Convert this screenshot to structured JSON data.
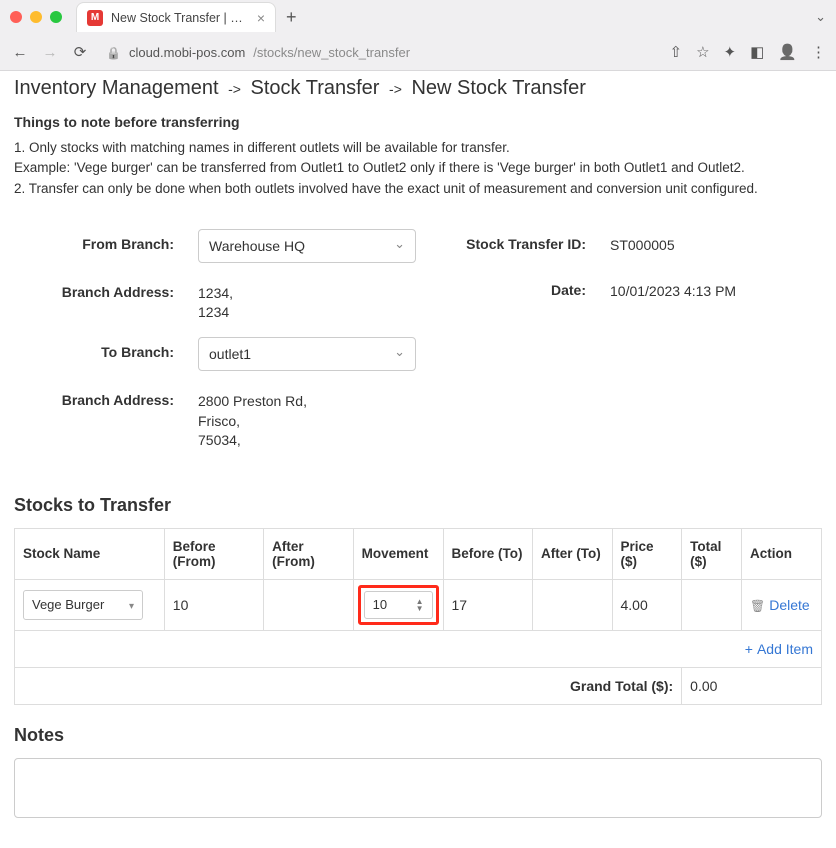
{
  "browser": {
    "tab_title": "New Stock Transfer | MobiPOS",
    "favicon_letter": "M",
    "url_host": "cloud.mobi-pos.com",
    "url_path": "/stocks/new_stock_transfer"
  },
  "breadcrumbs": {
    "a": "Inventory Management",
    "b": "Stock Transfer",
    "c": "New Stock Transfer"
  },
  "instructions": {
    "heading": "Things to note before transferring",
    "line1": "1. Only stocks with matching names in different outlets will be available for transfer.",
    "line1b": "Example: 'Vege burger' can be transferred from Outlet1 to Outlet2 only if there is 'Vege burger' in both Outlet1 and Outlet2.",
    "line2": "2. Transfer can only be done when both outlets involved have the exact unit of measurement and conversion unit configured."
  },
  "form": {
    "from_branch_label": "From Branch:",
    "from_branch_value": "Warehouse HQ",
    "branch_address_label": "Branch Address:",
    "from_address_line1": "1234,",
    "from_address_line2": "1234",
    "to_branch_label": "To Branch:",
    "to_branch_value": "outlet1",
    "to_address_line1": "2800 Preston Rd,",
    "to_address_line2": "Frisco,",
    "to_address_line3": "75034,",
    "transfer_id_label": "Stock Transfer ID:",
    "transfer_id_value": "ST000005",
    "date_label": "Date:",
    "date_value": "10/01/2023 4:13 PM"
  },
  "stocks": {
    "heading": "Stocks to Transfer",
    "headers": {
      "name": "Stock Name",
      "before_from": "Before (From)",
      "after_from": "After (From)",
      "movement": "Movement",
      "before_to": "Before (To)",
      "after_to": "After (To)",
      "price": "Price ($)",
      "total": "Total ($)",
      "action": "Action"
    },
    "row": {
      "name": "Vege Burger",
      "before_from": "10",
      "after_from": "",
      "movement": "10",
      "before_to": "17",
      "after_to": "",
      "price": "4.00",
      "total": "",
      "delete": "Delete"
    },
    "add_item": "Add Item",
    "grand_total_label": "Grand Total ($):",
    "grand_total_value": "0.00"
  },
  "notes": {
    "heading": "Notes"
  }
}
